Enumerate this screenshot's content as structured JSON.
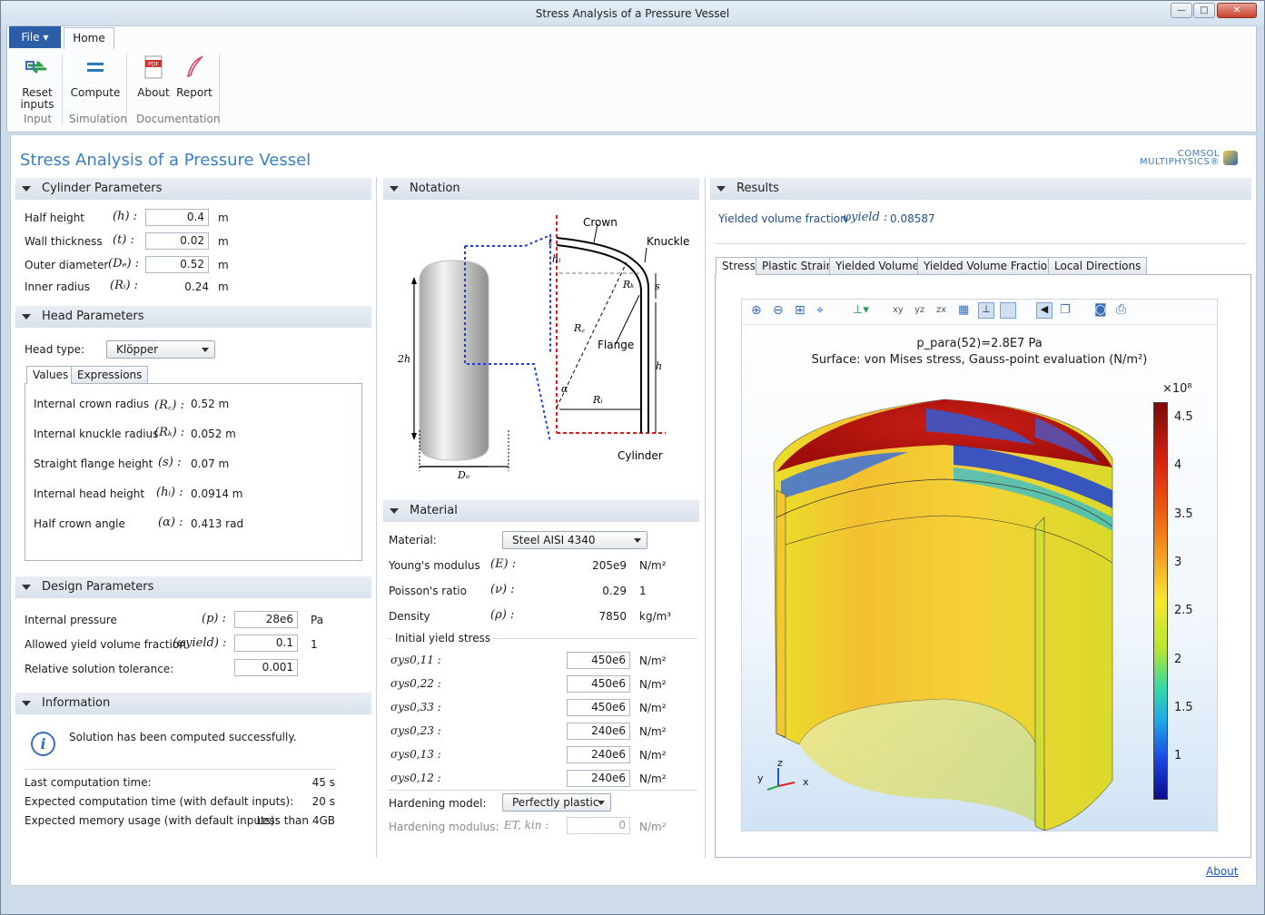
{
  "window": {
    "title": "Stress Analysis of a Pressure Vessel",
    "minimize": "—",
    "maximize": "□",
    "close": "✕"
  },
  "ribbon": {
    "file_tab": "File ▾",
    "home_tab": "Home",
    "buttons": [
      {
        "label": "Reset inputs",
        "icon": "reset-inputs-icon"
      },
      {
        "label": "Compute",
        "icon": "compute-icon"
      },
      {
        "label": "About",
        "icon": "pdf-icon"
      },
      {
        "label": "Report",
        "icon": "report-icon"
      }
    ],
    "groups": [
      "Input",
      "Simulation",
      "Documentation"
    ]
  },
  "app_title": "Stress Analysis of a Pressure Vessel",
  "logo": {
    "line1": "COMSOL",
    "line2": "MULTIPHYSICS®"
  },
  "cylinder": {
    "header": "Cylinder Parameters",
    "rows": [
      {
        "label": "Half height",
        "sym": "(h) :",
        "value": "0.4",
        "unit": "m"
      },
      {
        "label": "Wall thickness",
        "sym": "(t) :",
        "value": "0.02",
        "unit": "m"
      },
      {
        "label": "Outer diameter",
        "sym": "(Dₑ) :",
        "value": "0.52",
        "unit": "m"
      },
      {
        "label": "Inner radius",
        "sym": "(Rᵢ) :",
        "value": "0.24",
        "unit": "m"
      }
    ]
  },
  "head": {
    "header": "Head Parameters",
    "type_label": "Head type:",
    "type_value": "Klöpper",
    "tabs": [
      "Values",
      "Expressions"
    ],
    "rows": [
      {
        "label": "Internal crown radius",
        "sym": "(R꜀) :",
        "value": "0.52 m"
      },
      {
        "label": "Internal knuckle radius",
        "sym": "(Rₖ) :",
        "value": "0.052 m"
      },
      {
        "label": "Straight flange height",
        "sym": "(s) :",
        "value": "0.07 m"
      },
      {
        "label": "Internal head height",
        "sym": "(hᵢ) :",
        "value": "0.0914 m"
      },
      {
        "label": "Half crown angle",
        "sym": "(α) :",
        "value": "0.413 rad"
      }
    ]
  },
  "design": {
    "header": "Design Parameters",
    "rows": [
      {
        "label": "Internal pressure",
        "sym": "(p) :",
        "value": "28e6",
        "unit": "Pa"
      },
      {
        "label": "Allowed yield volume fraction",
        "sym": "(φyield) :",
        "value": "0.1",
        "unit": "1"
      },
      {
        "label": "Relative solution tolerance:",
        "sym": "",
        "value": "0.001",
        "unit": ""
      }
    ]
  },
  "info": {
    "header": "Information",
    "message": "Solution has been computed successfully.",
    "rows": [
      {
        "label": "Last computation time:",
        "value": "45 s"
      },
      {
        "label": "Expected computation time (with default inputs):",
        "value": "20 s"
      },
      {
        "label": "Expected memory usage (with default inputs):",
        "value": "Less than 4GB"
      }
    ]
  },
  "notation": {
    "header": "Notation",
    "labels": {
      "crown": "Crown",
      "knuckle": "Knuckle",
      "flange": "Flange",
      "cylinder": "Cylinder",
      "t": "t",
      "hi": "hᵢ",
      "rk": "Rₖ",
      "s": "s",
      "rc": "R꜀",
      "h": "h",
      "alpha": "α",
      "ri": "Rᵢ",
      "twoh": "2h",
      "de": "Dₑ"
    }
  },
  "material": {
    "header": "Material",
    "mat_label": "Material:",
    "mat_value": "Steel AISI 4340",
    "rows": [
      {
        "label": "Young's modulus",
        "sym": "(E) :",
        "value": "205e9",
        "unit": "N/m²"
      },
      {
        "label": "Poisson's ratio",
        "sym": "(ν) :",
        "value": "0.29",
        "unit": "1"
      },
      {
        "label": "Density",
        "sym": "(ρ) :",
        "value": "7850",
        "unit": "kg/m³"
      }
    ],
    "yield_header": "Initial yield stress",
    "yield": [
      {
        "sym": "σys0,11 :",
        "value": "450e6",
        "unit": "N/m²"
      },
      {
        "sym": "σys0,22 :",
        "value": "450e6",
        "unit": "N/m²"
      },
      {
        "sym": "σys0,33 :",
        "value": "450e6",
        "unit": "N/m²"
      },
      {
        "sym": "σys0,23 :",
        "value": "240e6",
        "unit": "N/m²"
      },
      {
        "sym": "σys0,13 :",
        "value": "240e6",
        "unit": "N/m²"
      },
      {
        "sym": "σys0,12 :",
        "value": "240e6",
        "unit": "N/m²"
      }
    ],
    "hardening_label": "Hardening model:",
    "hardening_value": "Perfectly plastic",
    "modulus_label": "Hardening modulus:",
    "modulus_sym": "ET, kin :",
    "modulus_value": "0",
    "modulus_unit": "N/m²"
  },
  "results": {
    "header": "Results",
    "yvf_label": "Yielded volume fraction",
    "yvf_sym": "φyield :",
    "yvf_value": "0.08587",
    "tabs": [
      "Stress",
      "Plastic Strain",
      "Yielded Volume",
      "Yielded Volume Fraction",
      "Local Directions"
    ],
    "plot_title1": "p_para(52)=2.8E7 Pa",
    "plot_title2": "Surface: von Mises stress, Gauss-point evaluation (N/m²)",
    "colorbar": {
      "exponent": "×10⁸",
      "ticks": [
        "4.5",
        "4",
        "3.5",
        "3",
        "2.5",
        "2",
        "1.5",
        "1"
      ]
    },
    "axes": {
      "x": "x",
      "y": "y",
      "z": "z"
    },
    "about_link": "About"
  }
}
